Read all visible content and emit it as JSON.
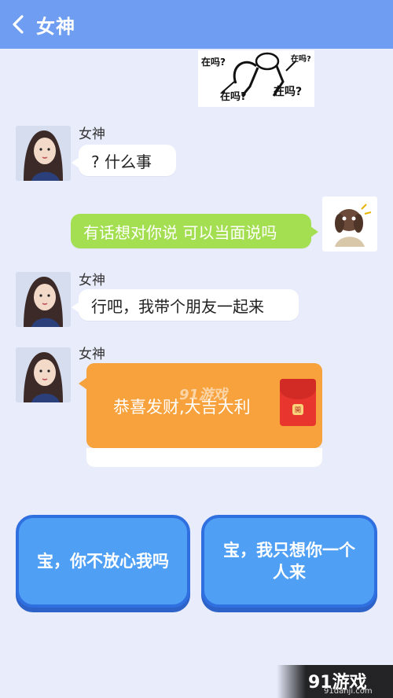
{
  "header": {
    "title": "女神",
    "back_icon": "chevron-left-icon"
  },
  "sticker": {
    "texts": [
      "在吗?",
      "在吗?",
      "在吗?",
      "在吗?"
    ]
  },
  "messages": [
    {
      "sender": "女神",
      "text": "? 什么事"
    },
    {
      "sender": "me",
      "text": "有话想对你说 可以当面说吗"
    },
    {
      "sender": "女神",
      "text": "行吧，我带个朋友一起来"
    },
    {
      "sender": "女神",
      "redpacket": "恭喜发财,大吉大利"
    }
  ],
  "redpacket_seal": "開",
  "choices": [
    "宝，你不放心我吗",
    "宝，我只想你一个人来"
  ],
  "watermark": {
    "center": "91游戏",
    "brand": "91游戏",
    "url": "91danji.com"
  },
  "colors": {
    "header": "#6f9df2",
    "green_bubble": "#a4df51",
    "redpacket": "#f7a23c",
    "choice": "#4f9ff5"
  }
}
